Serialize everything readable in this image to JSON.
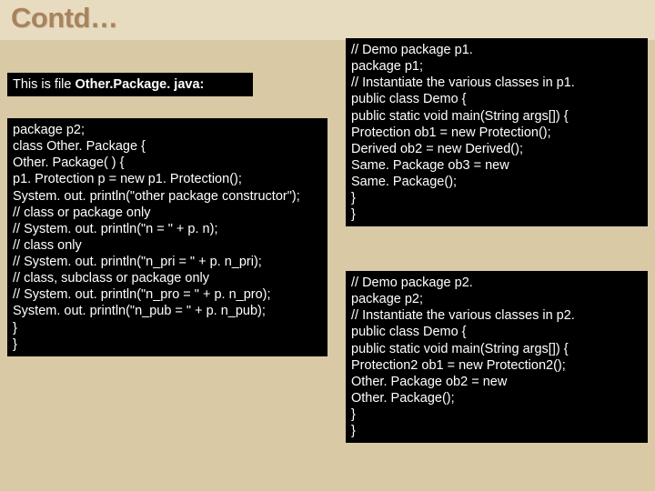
{
  "title": "Contd…",
  "leftHeader": {
    "prefix": "This is file ",
    "bold": "Other.Package. java:"
  },
  "leftCode": [
    "package p2;",
    "class Other. Package {",
    "Other. Package( ) {",
    "p1. Protection p = new p1. Protection();",
    "System. out. println(\"other package constructor\");",
    "// class or package only",
    "// System. out. println(\"n = \" + p. n);",
    "// class only",
    "// System. out. println(\"n_pri = \" + p. n_pri);",
    "// class, subclass or package only",
    "// System. out. println(\"n_pro = \" + p. n_pro);",
    "System. out. println(\"n_pub = \" + p. n_pub);",
    "}",
    "}"
  ],
  "rightTop": [
    "// Demo package p1.",
    "package p1;",
    "// Instantiate the various classes in p1.",
    "public class Demo {",
    "public static void main(String args[]) {",
    "Protection ob1 = new Protection();",
    "Derived ob2 = new Derived();",
    "Same. Package ob3 = new",
    "Same. Package();",
    "}",
    "}"
  ],
  "rightBottom": [
    "// Demo package p2.",
    "package p2;",
    "// Instantiate the various classes in p2.",
    "public class Demo {",
    "public static void main(String args[]) {",
    "Protection2 ob1 = new Protection2();",
    "Other. Package ob2 = new",
    "Other. Package();",
    "}",
    "}"
  ]
}
